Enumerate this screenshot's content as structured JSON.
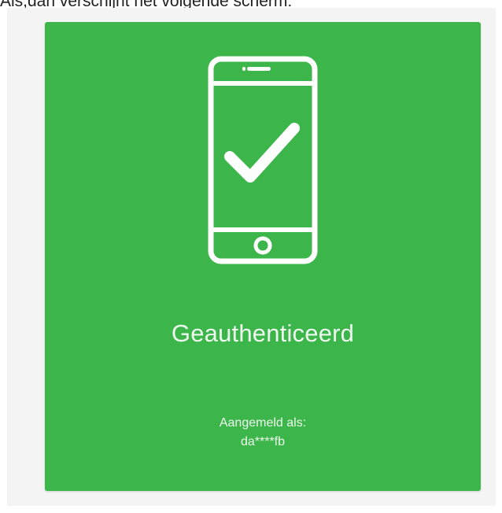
{
  "header": {
    "intro_text": "Als,dan verschijnt het volgende scherm:"
  },
  "card": {
    "accent_color": "#3cb54a",
    "icon": "smartphone-check-icon",
    "title": "Geauthenticeerd",
    "signed_in_label": "Aangemeld als:",
    "username": "da****fb"
  }
}
